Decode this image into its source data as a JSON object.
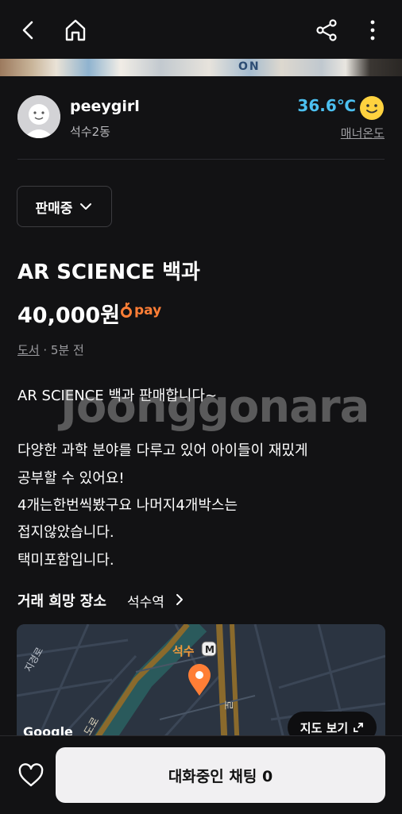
{
  "topbar": {
    "back": "back-icon",
    "home": "home-icon",
    "share": "share-icon",
    "more": "more-vertical-icon"
  },
  "photo": {
    "visible_text": "ON"
  },
  "seller": {
    "name": "peeygirl",
    "location": "석수2동",
    "temperature": "36.6℃",
    "manner_label": "매너온도"
  },
  "listing": {
    "status": "판매중",
    "title": "AR SCIENCE 백과",
    "price": "40,000원",
    "pay_label": "pay",
    "category": "도서",
    "time": " · 5분 전",
    "description": [
      "AR SCIENCE 백과 판매합니다~",
      "",
      "다양한 과학 분야를 다루고 있어 아이들이 재밌게",
      "공부할 수 있어요!",
      "4개는한번씩봤구요 나머지4개박스는",
      "접지않았습니다.",
      "택미포함입니다."
    ],
    "watermark": "Joonggonara"
  },
  "place": {
    "label": "거래 희망 장소",
    "value": "석수역",
    "map": {
      "station": "석수",
      "station_badge": "M",
      "road_labels": [
        "지경로",
        "도로",
        "로"
      ],
      "google": "Google",
      "view_button": "지도 보기"
    }
  },
  "bottom": {
    "chat_button": "대화중인 채팅 0",
    "like_icon": "heart-icon"
  },
  "colors": {
    "background": "#121214",
    "accent_orange": "#ff7e36",
    "temperature_blue": "#4cc0f0"
  }
}
